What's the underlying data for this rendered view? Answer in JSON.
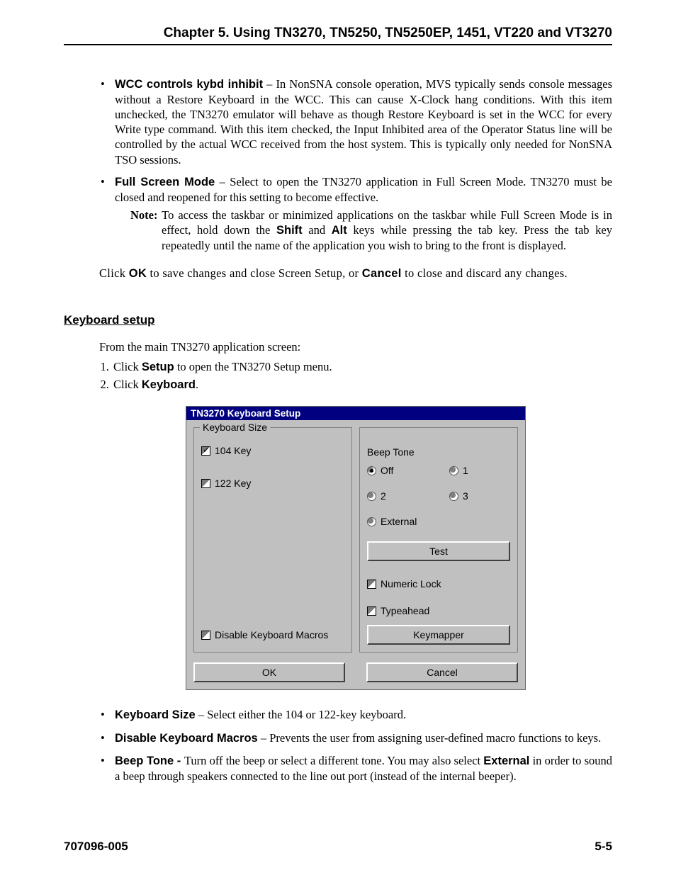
{
  "header": {
    "title": "Chapter 5.  Using  TN3270, TN5250, TN5250EP, 1451, VT220 and VT3270"
  },
  "bullets_top": {
    "wcc_label": "WCC controls kybd inhibit",
    "wcc_text": " – In NonSNA console operation, MVS typically sends console messages without a Restore Keyboard in the WCC. This can cause X-Clock hang conditions. With this item unchecked, the TN3270 emulator will behave as though Restore Keyboard is set in the WCC for every Write type command. With this item checked, the Input Inhibited area of the Operator Status line will be controlled by the actual WCC received from the host system. This is typically only needed for NonSNA TSO sessions.",
    "fsm_label": "Full Screen Mode",
    "fsm_text": " – Select to open the TN3270 application in Full Screen Mode. TN3270 must be closed and reopened for this setting to become effective.",
    "note_label": "Note:",
    "note_text_a": " To access the taskbar or minimized applications on the taskbar while Full Screen Mode is in effect, hold down the ",
    "shift": "Shift",
    "and": " and ",
    "alt": "Alt",
    "note_text_b": " keys while pressing the tab key. Press the tab key repeatedly until the name of the application you wish to bring to the front is displayed."
  },
  "click_ok": {
    "pre": "Click ",
    "ok": "OK",
    "mid": " to save changes and close Screen Setup, or ",
    "cancel": "Cancel",
    "post": " to close and discard any changes."
  },
  "section": {
    "heading": "Keyboard setup",
    "intro": "From the main TN3270 application screen:"
  },
  "steps": {
    "s1a": "Click ",
    "s1b": "Setup",
    "s1c": " to open the TN3270 Setup menu.",
    "s2a": "Click ",
    "s2b": "Keyboard",
    "s2c": "."
  },
  "dialog": {
    "title": "TN3270 Keyboard Setup",
    "group_kbsize": "Keyboard Size",
    "cb_104": "104 Key",
    "cb_122": "122 Key",
    "cb_disable_macros": "Disable Keyboard Macros",
    "beep_label": "Beep Tone",
    "r_off": "Off",
    "r_1": "1",
    "r_2": "2",
    "r_3": "3",
    "r_ext": "External",
    "btn_test": "Test",
    "cb_numlock": "Numeric Lock",
    "cb_typeahead": "Typeahead",
    "btn_keymapper": "Keymapper",
    "btn_ok": "OK",
    "btn_cancel": "Cancel"
  },
  "bullets_bottom": {
    "kbsize_label": "Keyboard Size",
    "kbsize_text": " – Select either the 104 or 122-key keyboard.",
    "dkm_label": "Disable Keyboard Macros",
    "dkm_text": " – Prevents the user from assigning user-defined macro functions to keys.",
    "beep_label": "Beep Tone - ",
    "beep_text_a": "Turn off the beep or select a different tone. You may also select ",
    "beep_ext": "External",
    "beep_text_b": " in order to sound a beep through speakers connected to the line out port (instead of the internal beeper)."
  },
  "footer": {
    "left": "707096-005",
    "right": "5-5"
  }
}
